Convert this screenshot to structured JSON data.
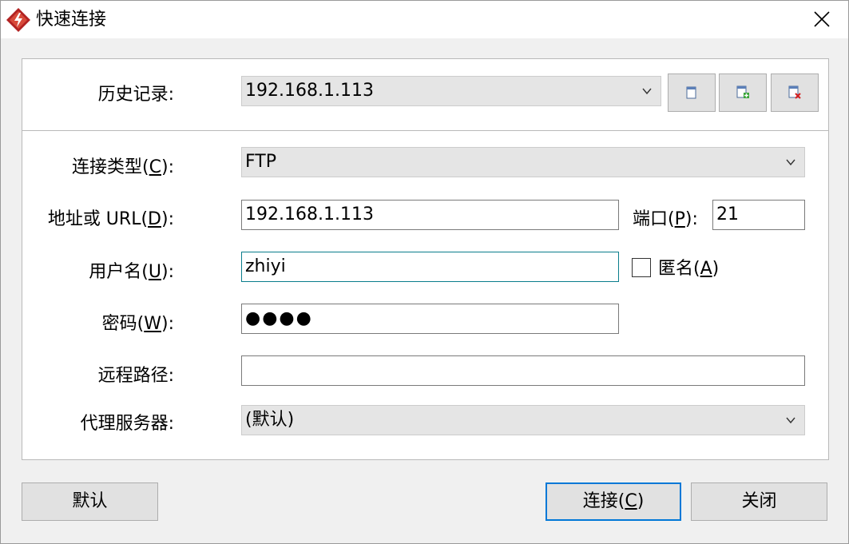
{
  "window": {
    "title": "快速连接"
  },
  "history": {
    "label": "历史记录:",
    "value": "192.168.1.113"
  },
  "connection_type": {
    "label_prefix": "连接类型(",
    "label_key": "C",
    "label_suffix": "):",
    "value": "FTP"
  },
  "address": {
    "label_prefix": "地址或 URL(",
    "label_key": "D",
    "label_suffix": "):",
    "value": "192.168.1.113"
  },
  "port": {
    "label_prefix": "端口(",
    "label_key": "P",
    "label_suffix": "):",
    "value": "21"
  },
  "username": {
    "label_prefix": "用户名(",
    "label_key": "U",
    "label_suffix": "):",
    "value": "zhiyi"
  },
  "anonymous": {
    "label_prefix": "匿名(",
    "label_key": "A",
    "label_suffix": ")",
    "checked": false
  },
  "password": {
    "label_prefix": "密码(",
    "label_key": "W",
    "label_suffix": "):",
    "masked_value": "●●●●"
  },
  "remote_path": {
    "label": "远程路径:",
    "value": ""
  },
  "proxy": {
    "label": "代理服务器:",
    "value": "(默认)"
  },
  "buttons": {
    "default_label": "默认",
    "connect_prefix": "连接(",
    "connect_key": "C",
    "connect_suffix": ")",
    "close_label": "关闭"
  },
  "icons": {
    "app": "lightning-app-icon",
    "close": "close-icon",
    "history_new": "new-document-icon",
    "history_add": "add-document-icon",
    "history_delete": "delete-document-icon",
    "dropdown": "chevron-down-icon"
  },
  "colors": {
    "focus_border": "#0a7d8c",
    "primary_border": "#0078d7",
    "app_icon_red": "#b22222"
  }
}
